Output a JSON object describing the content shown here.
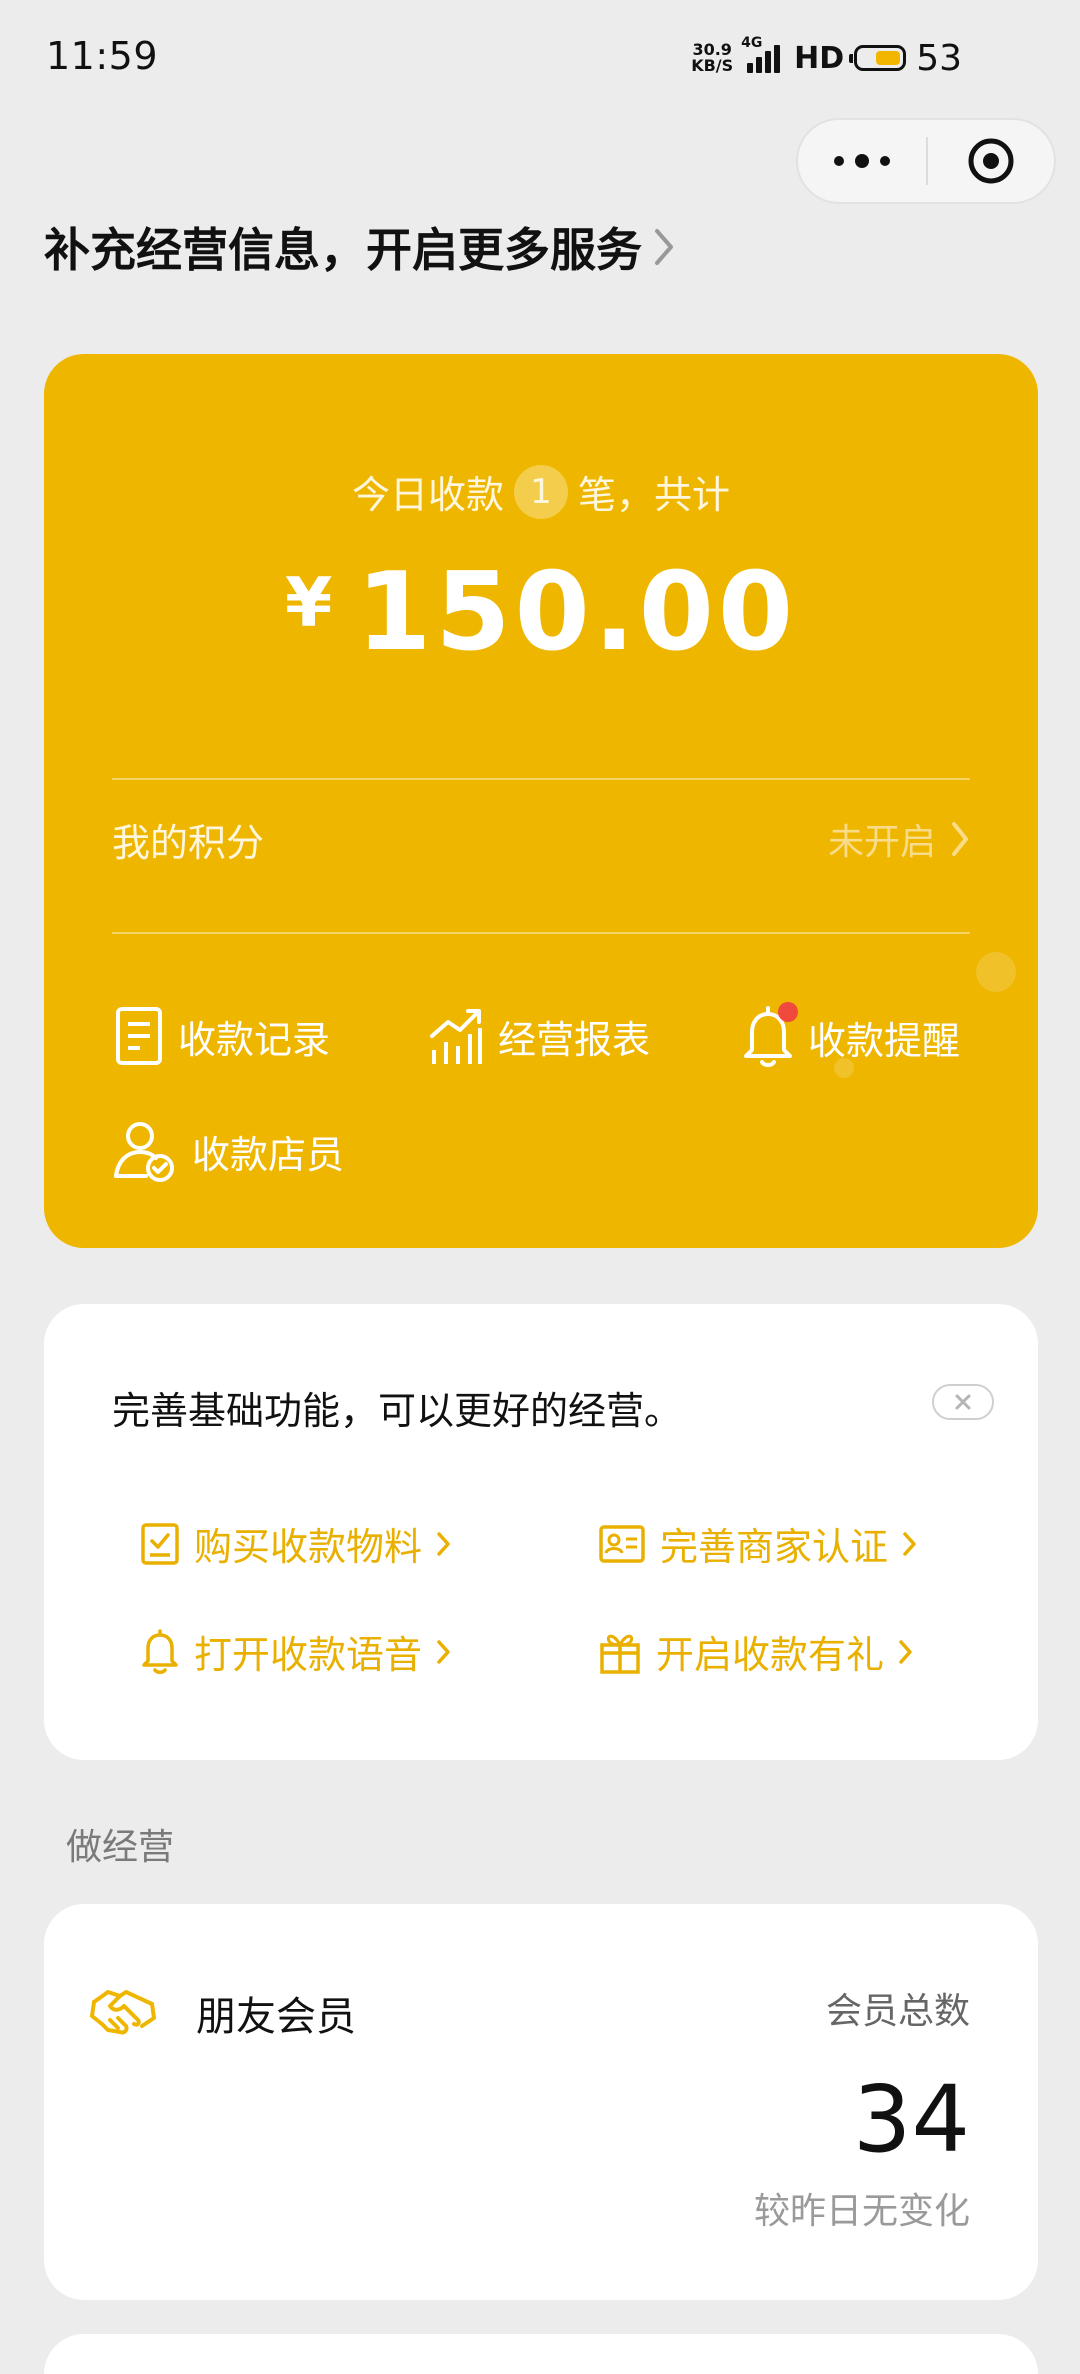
{
  "status_bar": {
    "time": "11:59",
    "network_speed_value": "30.9",
    "network_speed_unit": "KB/S",
    "network_type": "4G",
    "hd": "HD",
    "battery_level": "53",
    "battery_fill": 0.53
  },
  "header": {
    "title": "补充经营信息，开启更多服务"
  },
  "payment_card": {
    "today_prefix": "今日收款",
    "today_count": "1",
    "today_suffix": "笔，共计",
    "currency_symbol": "¥",
    "amount": "150.00",
    "points_label": "我的积分",
    "points_status": "未开启",
    "quick_actions": [
      {
        "label": "收款记录",
        "icon": "receipt-icon"
      },
      {
        "label": "经营报表",
        "icon": "chart-icon"
      },
      {
        "label": "收款提醒",
        "icon": "bell-icon",
        "has_red_dot": true
      },
      {
        "label": "收款店员",
        "icon": "staff-icon"
      }
    ],
    "colors": {
      "card_background": "#efb600",
      "text": "#ffffff",
      "red_dot": "#f04a3f"
    }
  },
  "tips_card": {
    "title": "完善基础功能，可以更好的经营。",
    "links": [
      {
        "label": "购买收款物料",
        "icon": "material-icon"
      },
      {
        "label": "完善商家认证",
        "icon": "id-card-icon"
      },
      {
        "label": "打开收款语音",
        "icon": "bell-icon"
      },
      {
        "label": "开启收款有礼",
        "icon": "gift-icon"
      }
    ],
    "accent_color": "#e9b000"
  },
  "business_section": {
    "label": "做经营",
    "member_card": {
      "title": "朋友会员",
      "icon": "handshake-icon",
      "total_label": "会员总数",
      "total_value": "34",
      "change_text": "较昨日无变化"
    }
  }
}
